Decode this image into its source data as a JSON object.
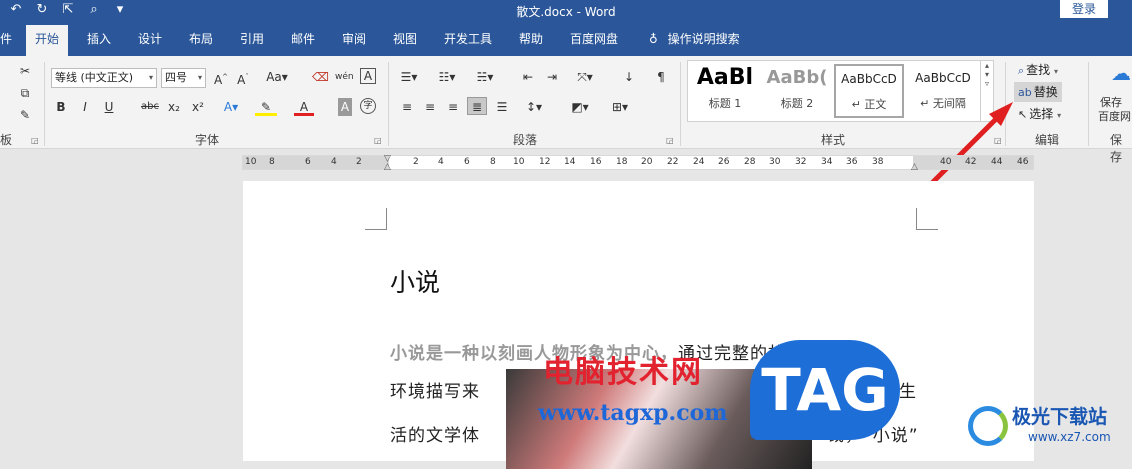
{
  "titlebar": {
    "doc_title": "散文.docx  -  Word",
    "login": "登录",
    "qat": [
      "↶",
      "↻",
      "⇱",
      "⌕",
      "▾"
    ]
  },
  "tabs": [
    "件",
    "开始",
    "插入",
    "设计",
    "布局",
    "引用",
    "邮件",
    "审阅",
    "视图",
    "开发工具",
    "帮助",
    "百度网盘"
  ],
  "active_tab": "开始",
  "tell_me": "操作说明搜索",
  "ribbon": {
    "groups": {
      "clipboard": "板",
      "font": "字体",
      "paragraph": "段落",
      "styles": "样式",
      "editing": "编辑",
      "save": "保存"
    },
    "font_name": "等线 (中文正文)",
    "font_size": "四号",
    "font_buttons": [
      "B",
      "I",
      "U",
      "abc",
      "x₂",
      "x²"
    ],
    "styles": [
      {
        "preview": "AaBl",
        "name": "标题 1"
      },
      {
        "preview": "AaBb(",
        "name": "标题 2"
      },
      {
        "preview": "AaBbCcD",
        "name": "↵ 正文"
      },
      {
        "preview": "AaBbCcD",
        "name": "↵ 无间隔"
      }
    ],
    "editing": {
      "find": "查找",
      "replace": "替换",
      "select": "选择"
    },
    "save_label_1": "保存",
    "save_label_2": "百度网"
  },
  "ruler": {
    "numbers": [
      "10",
      "8",
      "6",
      "4",
      "2",
      "2",
      "4",
      "6",
      "8",
      "10",
      "12",
      "14",
      "16",
      "18",
      "20",
      "22",
      "24",
      "26",
      "28",
      "30",
      "32",
      "34",
      "36",
      "38",
      "40",
      "42",
      "44",
      "46"
    ]
  },
  "document": {
    "heading": "小说",
    "line1_bold": "小说是一种以刻画人物形象为中心，",
    "line1_rest": "通过完整的故事情节和",
    "line2_left": "环境描写来",
    "line2_right": "反映社会生",
    "line3_left": "活的文学体",
    "line3_right": "裁，“小说”"
  },
  "watermarks": {
    "site_cn": "电脑技术网",
    "site_url": "www.tagxp.com",
    "tag": "TAG",
    "xz_cn": "极光下载站",
    "xz_url": "www.xz7.com"
  },
  "colors": {
    "brand": "#2b579a",
    "arrow": "#e02020"
  }
}
